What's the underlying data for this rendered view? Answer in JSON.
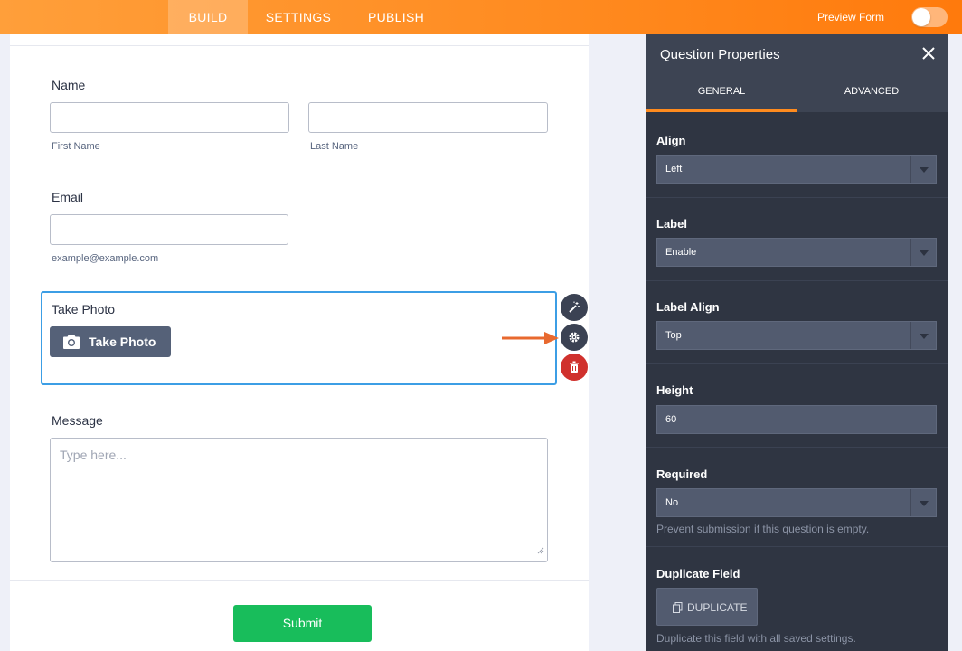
{
  "topbar": {
    "tabs": [
      {
        "label": "BUILD",
        "active": true
      },
      {
        "label": "SETTINGS",
        "active": false
      },
      {
        "label": "PUBLISH",
        "active": false
      }
    ],
    "preview_label": "Preview Form",
    "preview_enabled": false
  },
  "form": {
    "name_label": "Name",
    "first_name_sublabel": "First Name",
    "last_name_sublabel": "Last Name",
    "first_name_value": "",
    "last_name_value": "",
    "email_label": "Email",
    "email_sublabel": "example@example.com",
    "email_value": "",
    "photo_label": "Take Photo",
    "photo_button": "Take Photo",
    "message_label": "Message",
    "message_placeholder": "Type here...",
    "submit_label": "Submit"
  },
  "panel": {
    "title": "Question Properties",
    "tabs": [
      {
        "label": "GENERAL",
        "active": true
      },
      {
        "label": "ADVANCED",
        "active": false
      }
    ],
    "align": {
      "label": "Align",
      "value": "Left"
    },
    "label": {
      "label": "Label",
      "value": "Enable"
    },
    "label_align": {
      "label": "Label Align",
      "value": "Top"
    },
    "height": {
      "label": "Height",
      "value": "60"
    },
    "required": {
      "label": "Required",
      "value": "No",
      "hint": "Prevent submission if this question is empty."
    },
    "duplicate": {
      "label": "Duplicate Field",
      "button": "DUPLICATE",
      "hint": "Duplicate this field with all saved settings."
    }
  },
  "colors": {
    "accent_orange": "#ff8b1e",
    "selected_border": "#3c9ee5",
    "submit_green": "#18bd5b",
    "panel_bg": "#2f3542",
    "delete_red": "#d0312d"
  },
  "icons": [
    "toggle-switch",
    "camera-icon",
    "wand-icon",
    "gear-icon",
    "trash-icon",
    "close-icon",
    "copy-icon",
    "arrow-icon",
    "chevron-down-icon",
    "resize-grip-icon"
  ]
}
